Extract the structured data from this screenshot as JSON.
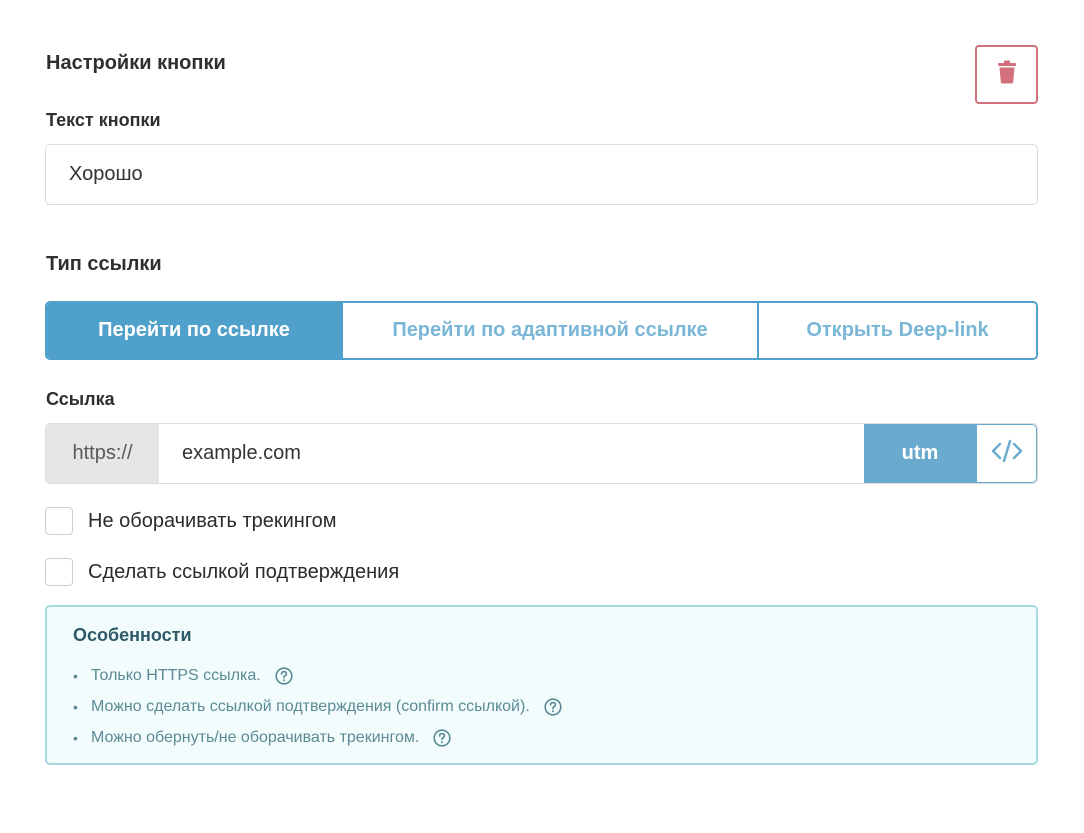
{
  "header": {
    "title": "Настройки кнопки"
  },
  "button_text": {
    "label": "Текст кнопки",
    "value": "Хорошо"
  },
  "link_type": {
    "label": "Тип ссылки",
    "options": [
      "Перейти по ссылке",
      "Перейти по адаптивной ссылке",
      "Открыть Deep-link"
    ],
    "selected": "Перейти по ссылке"
  },
  "link": {
    "label": "Ссылка",
    "prefix": "https://",
    "value": "example.com",
    "utm_label": "utm"
  },
  "checkboxes": [
    {
      "label": "Не оборачивать трекингом",
      "checked": false
    },
    {
      "label": "Сделать ссылкой подтверждения",
      "checked": false
    }
  ],
  "features": {
    "title": "Особенности",
    "items": [
      "Только HTTPS ссылка.",
      "Можно сделать ссылкой подтверждения (confirm ссылкой).",
      "Можно обернуть/не оборачивать трекингом."
    ]
  },
  "colors": {
    "accent": "#4fa0ca",
    "utm": "#6baacf",
    "danger": "#d2717b",
    "info_bg": "#f3fcfc",
    "info_border": "#a8d8df"
  },
  "icons": {
    "delete": "trash-icon",
    "code": "code-icon",
    "help": "question-circle-icon"
  }
}
